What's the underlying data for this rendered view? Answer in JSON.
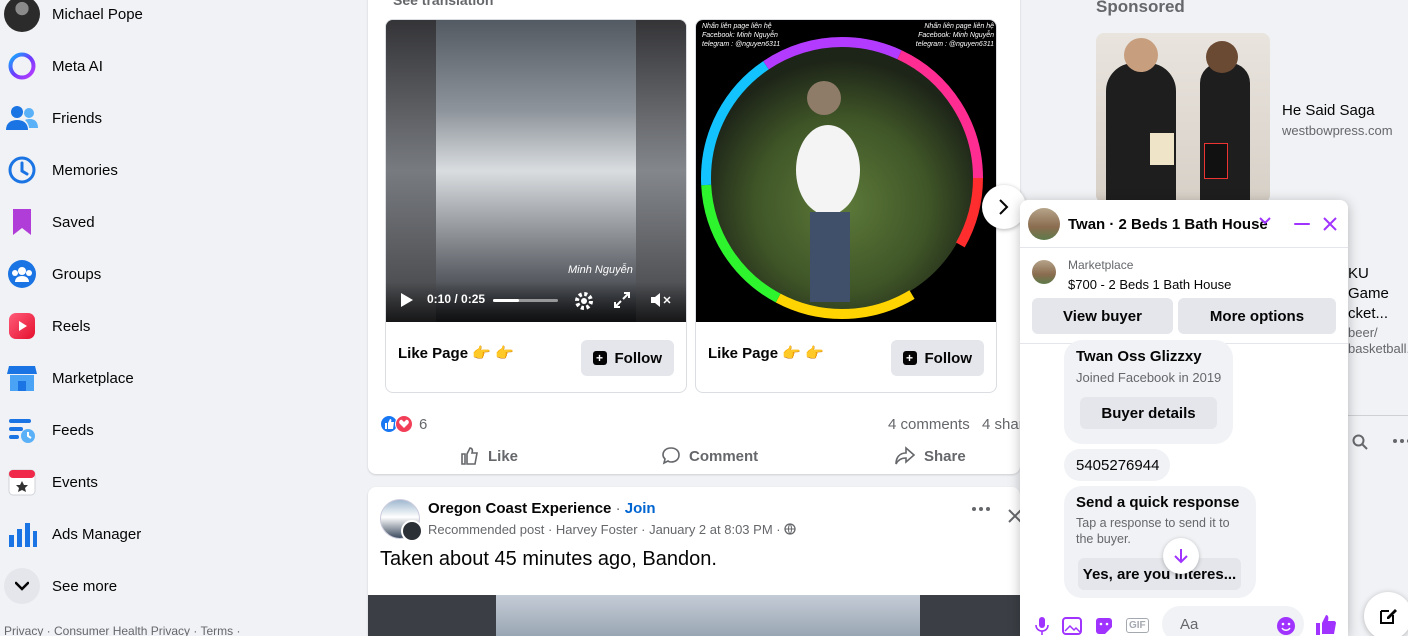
{
  "sidebar": {
    "items": [
      {
        "label": "Michael Pope",
        "icon": "profile-avatar"
      },
      {
        "label": "Meta AI",
        "icon": "meta-ai-icon"
      },
      {
        "label": "Friends",
        "icon": "friends-icon"
      },
      {
        "label": "Memories",
        "icon": "memories-icon"
      },
      {
        "label": "Saved",
        "icon": "saved-icon"
      },
      {
        "label": "Groups",
        "icon": "groups-icon"
      },
      {
        "label": "Reels",
        "icon": "reels-icon"
      },
      {
        "label": "Marketplace",
        "icon": "marketplace-icon"
      },
      {
        "label": "Feeds",
        "icon": "feeds-icon"
      },
      {
        "label": "Events",
        "icon": "events-icon"
      },
      {
        "label": "Ads Manager",
        "icon": "ads-manager-icon"
      },
      {
        "label": "See more",
        "icon": "chevron-down-icon"
      }
    ],
    "footer": "Privacy · Consumer Health Privacy · Terms ·"
  },
  "post1": {
    "see_translation": "See translation",
    "cards": [
      {
        "title": "Like Page 👉 👉",
        "follow": "Follow",
        "video_time": "0:10 / 0:25",
        "video_caption": "Minh Nguyễn"
      },
      {
        "title": "Like Page 👉 👉",
        "follow": "Follow",
        "watermark_left": "Nhấn liên page liên hệ Facebook: Minh Nguyễn telegram : @nguyen6311",
        "watermark_right": "Nhấn liên page liên hệ Facebook: Minh Nguyễn telegram : @nguyen6311"
      }
    ],
    "reaction_count": "6",
    "comments": "4 comments",
    "shares": "4 shar",
    "actions": {
      "like": "Like",
      "comment": "Comment",
      "share": "Share"
    }
  },
  "post2": {
    "author": "Oregon Coast Experience",
    "join": "Join",
    "meta": "Recommended post · Harvey Foster · January 2 at 8:03 PM · ",
    "text": "Taken about 45 minutes ago, Bandon."
  },
  "rail": {
    "sponsored": "Sponsored",
    "ad1_title": "He Said Saga",
    "ad1_url": "westbowpress.com",
    "ad2_line1": "KU",
    "ad2_line2": "Game",
    "ad2_line3": "cket...",
    "ad2_sub1": "beer/",
    "ad2_sub2": "basketball..."
  },
  "chat": {
    "title": "Twan · 2 Beds 1 Bath House",
    "marketplace_label": "Marketplace",
    "listing": "$700 - 2 Beds 1 Bath House",
    "view_buyer": "View buyer",
    "more_options": "More options",
    "buyer_name": "Twan Oss Glizzxy",
    "buyer_joined": "Joined Facebook in 2019",
    "buyer_details": "Buyer details",
    "phone": "5405276944",
    "quick_title": "Send a quick response",
    "quick_sub": "Tap a response to send it to the buyer.",
    "quick_reply": "Yes, are you interes...",
    "input_placeholder": "Aa"
  },
  "colors": {
    "accent": "#0866ff",
    "chat_accent": "#a033ff"
  }
}
